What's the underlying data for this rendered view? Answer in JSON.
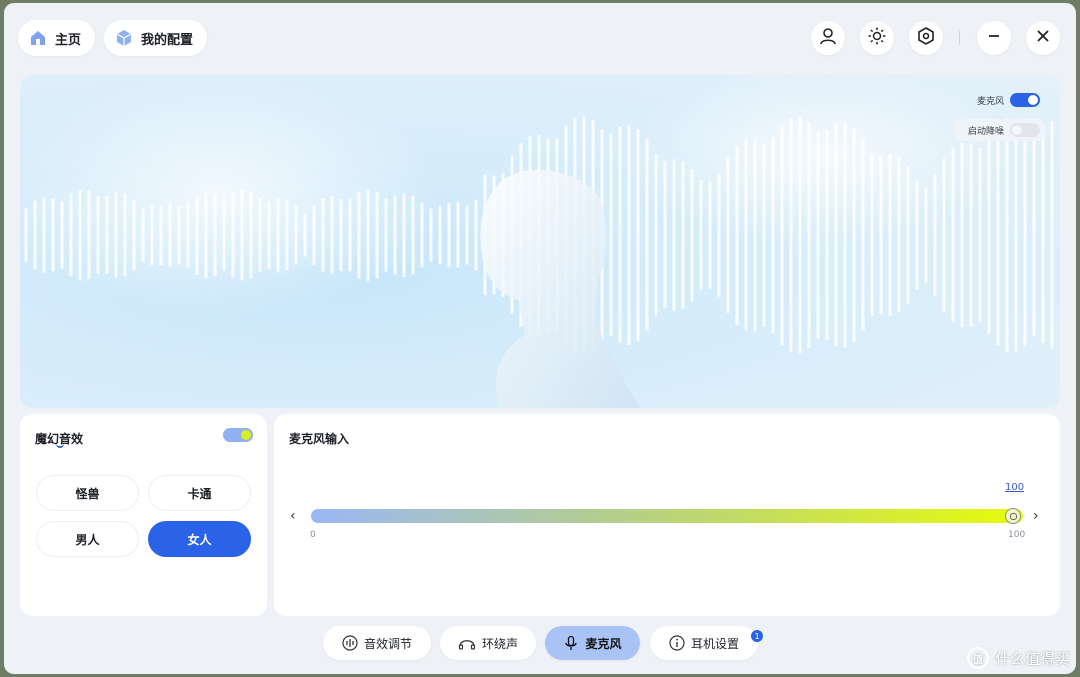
{
  "header": {
    "home_label": "主页",
    "config_label": "我的配置",
    "icons": [
      "user-icon",
      "brightness-icon",
      "settings-hex-icon",
      "minimize-icon",
      "close-icon"
    ]
  },
  "hero": {
    "mic_label": "麦克风",
    "mic_on": true,
    "denoise_label": "启动降噪",
    "denoise_on": false
  },
  "voice_fx": {
    "title": "魔幻音效",
    "enabled": true,
    "options": [
      "怪兽",
      "卡通",
      "男人",
      "女人"
    ],
    "selected": "女人"
  },
  "mic_input": {
    "title": "麦克风输入",
    "value": "100",
    "min_label": "0",
    "max_label": "100",
    "level": 1.0
  },
  "tabs": [
    {
      "label": "音效调节",
      "icon": "equalizer-icon"
    },
    {
      "label": "环绕声",
      "icon": "surround-icon"
    },
    {
      "label": "麦克风",
      "icon": "mic-icon",
      "active": true
    },
    {
      "label": "耳机设置",
      "icon": "info-icon",
      "badge": "1"
    }
  ],
  "watermark": {
    "text": "什么值得买",
    "logo": "值"
  },
  "colors": {
    "accent": "#2a62e8",
    "active_tab": "#a9c3f5",
    "slider_end": "#e6fb0a"
  }
}
